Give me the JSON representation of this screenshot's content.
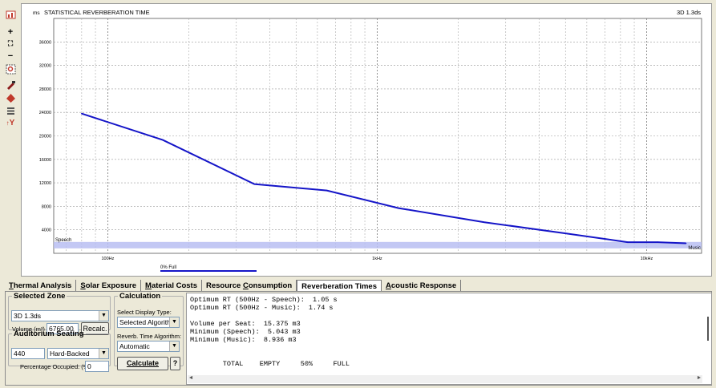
{
  "toolbar": {
    "icons": [
      "chart-icon",
      "zoom-in-icon",
      "fit-icon",
      "zoom-out-icon",
      "zoom-region-icon",
      "paint-icon",
      "color-icon",
      "list-icon",
      "y-axis-icon"
    ],
    "labels": {
      "plus": "+",
      "minus": "−",
      "fit": "⛶",
      "y": "Y"
    }
  },
  "chart": {
    "title": "STATISTICAL REVERBERATION TIME",
    "top_right_label": "3D 1.3ds",
    "y_unit": "ms",
    "speech_label": "Speech",
    "music_label": "Music",
    "legend_label": "0% Full",
    "line_color": "#1515c8",
    "band_color": "#b8bef2"
  },
  "chart_data": {
    "type": "line",
    "title": "STATISTICAL REVERBERATION TIME",
    "xlabel": "",
    "ylabel": "ms",
    "xscale": "log",
    "xlim": [
      63,
      16000
    ],
    "ylim": [
      0,
      40000
    ],
    "y_ticks": [
      4000,
      8000,
      12000,
      16000,
      20000,
      24000,
      28000,
      32000,
      36000
    ],
    "x_tick_labels": [
      {
        "x": 100,
        "label": "100Hz"
      },
      {
        "x": 1000,
        "label": "1kHz"
      },
      {
        "x": 10000,
        "label": "10kHz"
      }
    ],
    "grid": true,
    "series": [
      {
        "name": "0% Full",
        "x": [
          80,
          160,
          350,
          650,
          1200,
          2500,
          5000,
          8500,
          11000,
          14000
        ],
        "y": [
          23800,
          19300,
          11800,
          10700,
          7700,
          5300,
          3400,
          1900,
          1900,
          1700
        ]
      }
    ],
    "bands": [
      {
        "label_left": "Speech",
        "label_right": "Music",
        "y_from": 1043,
        "y_to": 1740
      }
    ]
  },
  "tabs": [
    {
      "key": "T",
      "rest": "hermal Analysis",
      "active": false
    },
    {
      "key": "S",
      "rest": "olar Exposure",
      "active": false
    },
    {
      "key": "M",
      "rest": "aterial Costs",
      "active": false
    },
    {
      "pre": "Resource ",
      "key": "C",
      "rest": "onsumption",
      "active": false
    },
    {
      "pre": "Reverberation Times",
      "key": "",
      "rest": "",
      "active": true
    },
    {
      "key": "A",
      "rest": "coustic Response",
      "active": false
    }
  ],
  "selected_zone": {
    "legend": "Selected Zone",
    "zone_value": "3D 1.3ds",
    "volume_label": "Volume (m³)",
    "volume_value": "6765.00",
    "recalc_label": "Recalc."
  },
  "seating": {
    "legend": "Auditorium Seating",
    "seats_value": "440",
    "type_value": "Hard-Backed",
    "occupied_label": "Percentage Occupied: (%)",
    "occupied_value": "0"
  },
  "calculation": {
    "legend": "Calculation",
    "display_type_label": "Select Display Type:",
    "display_type_value": "Selected Algorithm",
    "algorithm_label": "Reverb. Time Algorithm:",
    "algorithm_value": "Automatic",
    "calculate_label": "Calculate",
    "help_label": "?"
  },
  "output": {
    "lines": [
      "Optimum RT (500Hz - Speech):  1.05 s",
      "Optimum RT (500Hz - Music):  1.74 s",
      "",
      "Volume per Seat:  15.375 m3",
      "Minimum (Speech):  5.043 m3",
      "Minimum (Music):  8.936 m3",
      "",
      "",
      "        TOTAL    EMPTY     50%     FULL"
    ],
    "scroll_left": "◄",
    "scroll_right": "►"
  }
}
